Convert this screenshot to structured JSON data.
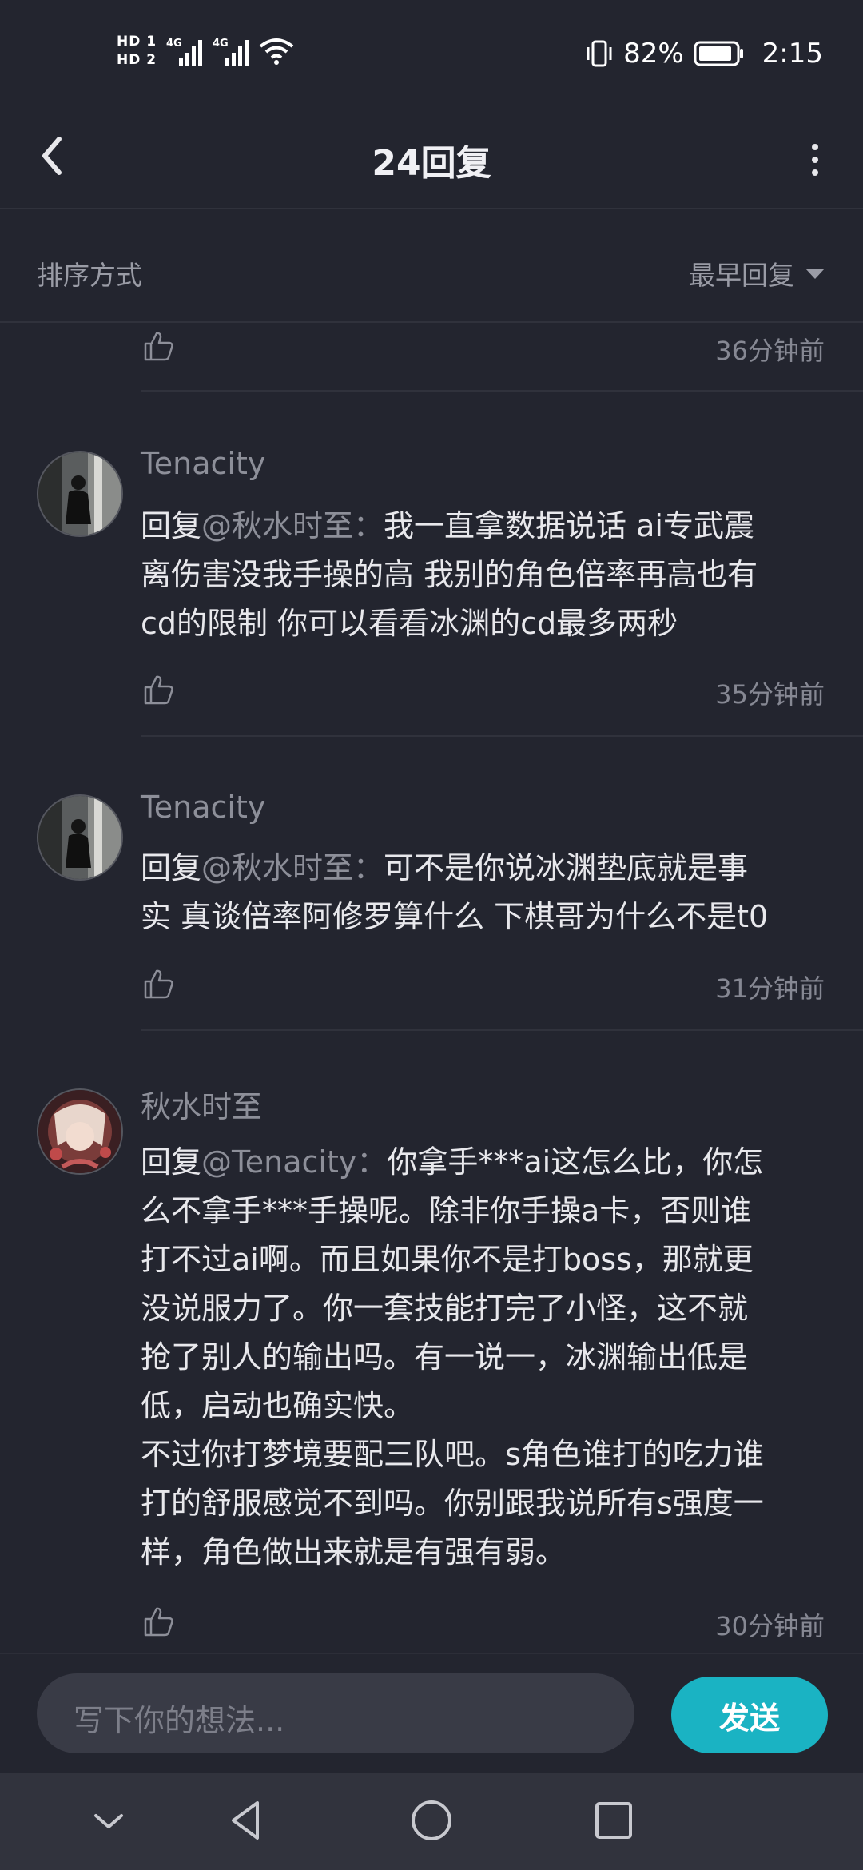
{
  "status_bar": {
    "hd1": "HD 1",
    "hd2": "HD 2",
    "net1": "4G",
    "net2": "4G",
    "battery": "82%",
    "time": "2:15"
  },
  "header": {
    "title": "24回复"
  },
  "sort": {
    "label": "排序方式",
    "value": "最早回复"
  },
  "partial_comment": {
    "time": "36分钟前"
  },
  "comments": [
    {
      "author": "Tenacity",
      "reply_prefix": "回复",
      "mention": "@秋水时至",
      "colon": "：",
      "text": "我一直拿数据说话 ai专武震\n离伤害没我手操的高 我别的角色倍率再高也有\ncd的限制 你可以看看冰渊的cd最多两秒",
      "time": "35分钟前"
    },
    {
      "author": "Tenacity",
      "reply_prefix": "回复",
      "mention": "@秋水时至",
      "colon": "：",
      "text": "可不是你说冰渊垫底就是事\n实 真谈倍率阿修罗算什么 下棋哥为什么不是t0",
      "time": "31分钟前"
    },
    {
      "author": "秋水时至",
      "reply_prefix": "回复",
      "mention": "@Tenacity",
      "colon": "：",
      "text": "你拿手***ai这怎么比，你怎\n么不拿手***手操呢。除非你手操a卡，否则谁\n打不过ai啊。而且如果你不是打boss，那就更\n没说服力了。你一套技能打完了小怪，这不就\n抢了别人的输出吗。有一说一，冰渊输出低是\n低，启动也确实快。\n不过你打梦境要配三队吧。s角色谁打的吃力谁\n打的舒服感觉不到吗。你别跟我说所有s强度一\n样，角色做出来就是有强有弱。",
      "time": "30分钟前"
    }
  ],
  "composer": {
    "placeholder": "写下你的想法...",
    "send_label": "发送"
  },
  "colors": {
    "background": "#23252f",
    "accent": "#1ab3c3",
    "muted_text": "#8d8f99"
  }
}
